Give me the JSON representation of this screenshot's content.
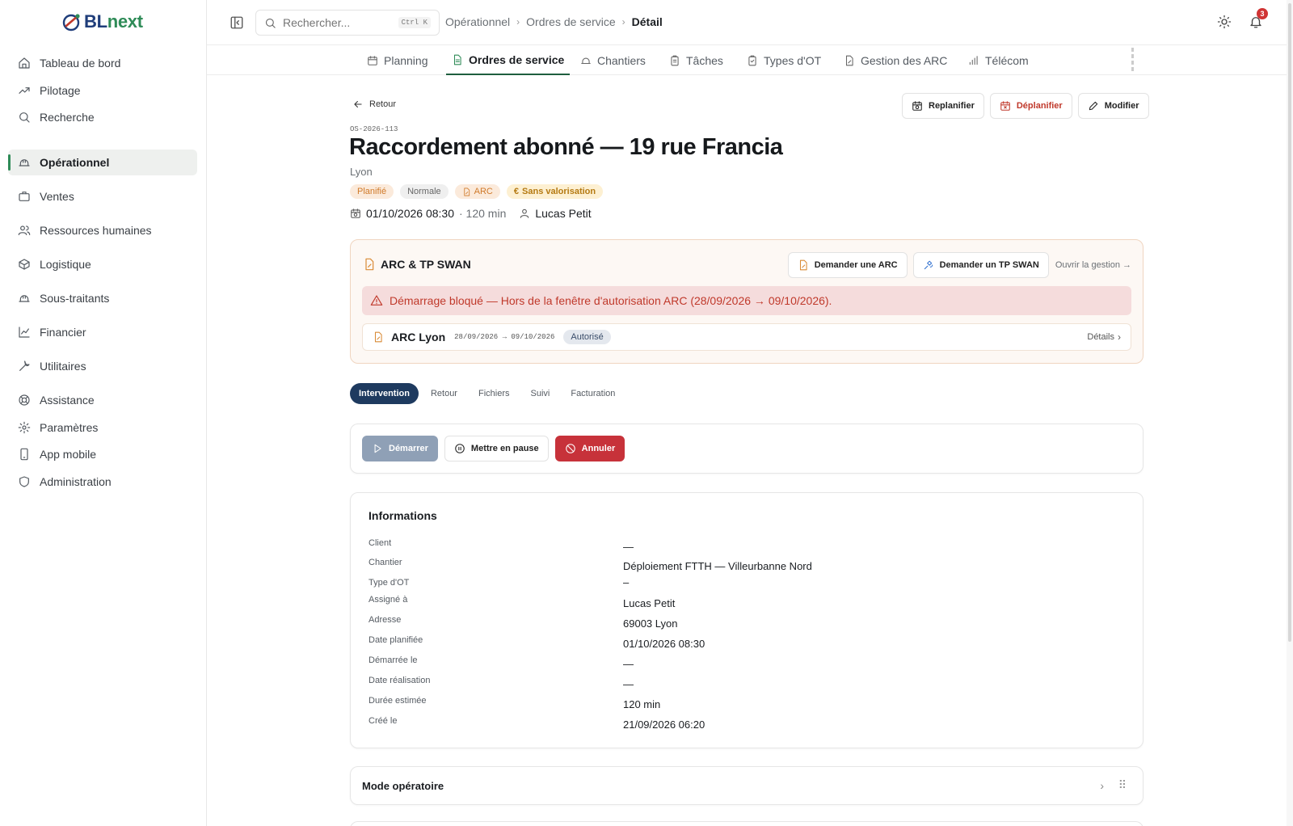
{
  "brand": {
    "name_part1": "BL",
    "name_part2": "next"
  },
  "sidebar": {
    "items": [
      {
        "label": "Tableau de bord",
        "icon": "home-icon"
      },
      {
        "label": "Pilotage",
        "icon": "trending-up-icon"
      },
      {
        "label": "Recherche",
        "icon": "search-icon"
      },
      {
        "label": "Opérationnel",
        "icon": "hard-hat-icon",
        "active": true
      },
      {
        "label": "Ventes",
        "icon": "briefcase-icon"
      },
      {
        "label": "Ressources humaines",
        "icon": "users-icon"
      },
      {
        "label": "Logistique",
        "icon": "package-icon"
      },
      {
        "label": "Sous-traitants",
        "icon": "hard-hat-icon"
      },
      {
        "label": "Financier",
        "icon": "line-chart-icon"
      },
      {
        "label": "Utilitaires",
        "icon": "wrench-icon"
      },
      {
        "label": "Assistance",
        "icon": "lifebuoy-icon"
      },
      {
        "label": "Paramètres",
        "icon": "gear-icon"
      },
      {
        "label": "App mobile",
        "icon": "smartphone-icon"
      },
      {
        "label": "Administration",
        "icon": "shield-icon"
      }
    ]
  },
  "topbar": {
    "search_placeholder": "Rechercher...",
    "search_shortcut": "Ctrl K",
    "breadcrumb": [
      "Opérationnel",
      "Ordres de service",
      "Détail"
    ],
    "notification_count": "3"
  },
  "tabs": [
    {
      "label": "Planning",
      "icon": "calendar-icon"
    },
    {
      "label": "Ordres de service",
      "icon": "document-icon",
      "active": true
    },
    {
      "label": "Chantiers",
      "icon": "hard-hat-icon"
    },
    {
      "label": "Tâches",
      "icon": "clipboard-icon"
    },
    {
      "label": "Types d'OT",
      "icon": "clipboard-check-icon"
    },
    {
      "label": "Gestion des ARC",
      "icon": "file-edit-icon"
    },
    {
      "label": "Télécom",
      "icon": "signal-icon"
    }
  ],
  "detail": {
    "back_label": "Retour",
    "actions": {
      "replan": "Replanifier",
      "unplan": "Déplanifier",
      "edit": "Modifier"
    },
    "ref": "OS-2026-113",
    "title": "Raccordement abonné — 19 rue Francia",
    "city": "Lyon",
    "badges": {
      "status": "Planifié",
      "priority": "Normale",
      "arc": "ARC",
      "valuation": "Sans valorisation"
    },
    "datetime": "01/10/2026 08:30",
    "duration": "· 120 min",
    "assignee": "Lucas Petit"
  },
  "arc_panel": {
    "title": "ARC & TP SWAN",
    "request_arc": "Demander une ARC",
    "request_swan": "Demander un TP SWAN",
    "open_link": "Ouvrir la gestion →",
    "alert": "Démarrage bloqué — Hors de la fenêtre d'autorisation ARC (28/09/2026 → 09/10/2026).",
    "row": {
      "name": "ARC Lyon",
      "dates": "28/09/2026 → 09/10/2026",
      "status": "Autorisé",
      "details": "Détails"
    }
  },
  "subtabs": [
    "Intervention",
    "Retour",
    "Fichiers",
    "Suivi",
    "Facturation"
  ],
  "intervention_actions": {
    "start": "Démarrer",
    "pause": "Mettre en pause",
    "cancel": "Annuler"
  },
  "info": {
    "title": "Informations",
    "rows": [
      {
        "label": "Client",
        "value": "—"
      },
      {
        "label": "Chantier",
        "value": "Déploiement FTTH — Villeurbanne Nord"
      },
      {
        "label": "Type d'OT",
        "value": "–"
      },
      {
        "label": "Assigné à",
        "value": "Lucas Petit"
      },
      {
        "label": "Adresse",
        "value": "69003 Lyon"
      },
      {
        "label": "Date planifiée",
        "value": "01/10/2026 08:30"
      },
      {
        "label": "Démarrée le",
        "value": "—"
      },
      {
        "label": "Date réalisation",
        "value": "—"
      },
      {
        "label": "Durée estimée",
        "value": "120 min"
      },
      {
        "label": "Créé le",
        "value": "21/09/2026 06:20"
      }
    ]
  },
  "mode_operatoire": {
    "title": "Mode opératoire"
  },
  "colors": {
    "accent_green": "#2e8b57",
    "navy": "#1e3a5f",
    "danger": "#c7323a",
    "warning_orange": "#d98a35"
  }
}
